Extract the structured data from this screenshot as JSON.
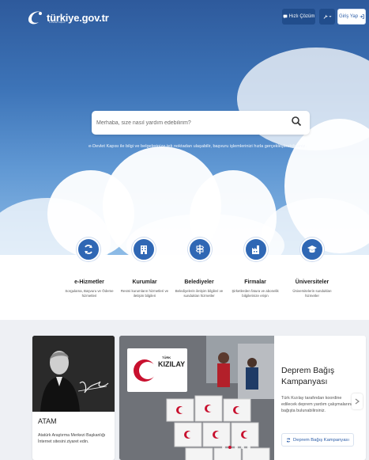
{
  "header": {
    "logo_text": "türkiye.gov.tr",
    "logo_subtext": "e-Devlet Kapısı",
    "quick_solution_label": "Hızlı Çözüm",
    "login_label": "Giriş Yap"
  },
  "search": {
    "placeholder": "Merhaba, size nasıl yardım edebilirim?",
    "description": "e-Devlet Kapısı ile bilgi ve belgelerinize tek noktadan ulaşabilir, başvuru işlemlerinizi hızla gerçekleştirebilirsiniz."
  },
  "services": [
    {
      "title": "e-Hizmetler",
      "desc_1": "Sorgulama, Başvuru ve Ödeme",
      "desc_2": "hizmetleri",
      "icon": "refresh-icon"
    },
    {
      "title": "Kurumlar",
      "desc_1": "Resmi kurumların hizmetleri ve",
      "desc_2": "iletişim bilgileri",
      "icon": "building-icon"
    },
    {
      "title": "Belediyeler",
      "desc_1": "Belediyelerin iletişim bilgileri ve",
      "desc_2": "sundukları hizmetler",
      "icon": "signpost-icon"
    },
    {
      "title": "Firmalar",
      "desc_1": "Şirketlerden fatura ve abonelik",
      "desc_2": "bilgilerinize erişin",
      "icon": "factory-icon"
    },
    {
      "title": "Üniversiteler",
      "desc_1": "Üniversitelerin sundukları",
      "desc_2": "hizmetler",
      "icon": "graduation-cap-icon"
    }
  ],
  "atam": {
    "title": "ATAM",
    "desc": "Atatürk Araştırma Merkezi Başkanlığı İnternet sitesini ziyaret edin."
  },
  "campaign": {
    "logo_small": "TÜRK",
    "logo_big": "KIZILAY",
    "title": "Deprem Bağış Kampanyası",
    "desc": "Türk Kızılay tarafından koordine edilecek deprem yardım çalışmalarına bağışta bulunabilirsiniz.",
    "button_label": "Deprem Bağış Kampanyası"
  },
  "colors": {
    "accent": "#2f67b4",
    "header_button": "#214d8c",
    "kizilay_red": "#c8102e"
  }
}
